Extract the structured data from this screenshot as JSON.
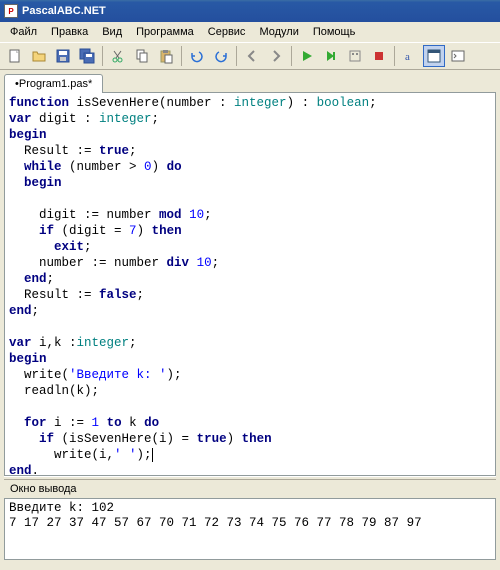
{
  "title": "PascalABC.NET",
  "menu": [
    "Файл",
    "Правка",
    "Вид",
    "Программа",
    "Сервис",
    "Модули",
    "Помощь"
  ],
  "tab": "•Program1.pas*",
  "output_title": "Окно вывода",
  "output_lines": [
    "Введите k: 102",
    "7 17 27 37 47 57 67 70 71 72 73 74 75 76 77 78 79 87 97 "
  ],
  "code": {
    "l1a": "function",
    "l1b": " isSevenHere(number : ",
    "l1c": "integer",
    "l1d": ") : ",
    "l1e": "boolean",
    "l1f": ";",
    "l2a": "var",
    "l2b": " digit : ",
    "l2c": "integer",
    "l2d": ";",
    "l3": "begin",
    "l4a": "  Result := ",
    "l4b": "true",
    "l4c": ";",
    "l5a": "  ",
    "l5b": "while",
    "l5c": " (number > ",
    "l5d": "0",
    "l5e": ") ",
    "l5f": "do",
    "l6": "  begin",
    "l7": "",
    "l8a": "    digit := number ",
    "l8b": "mod",
    "l8c": " ",
    "l8d": "10",
    "l8e": ";",
    "l9a": "    ",
    "l9b": "if",
    "l9c": " (digit = ",
    "l9d": "7",
    "l9e": ") ",
    "l9f": "then",
    "l10a": "      ",
    "l10b": "exit",
    "l10c": ";",
    "l11a": "    number := number ",
    "l11b": "div",
    "l11c": " ",
    "l11d": "10",
    "l11e": ";",
    "l12a": "  ",
    "l12b": "end",
    "l12c": ";",
    "l13a": "  Result := ",
    "l13b": "false",
    "l13c": ";",
    "l14a": "end",
    "l14b": ";",
    "l15": "",
    "l16a": "var",
    "l16b": " i,k :",
    "l16c": "integer",
    "l16d": ";",
    "l17": "begin",
    "l18a": "  write(",
    "l18b": "'Введите k: '",
    "l18c": ");",
    "l19": "  readln(k);",
    "l20": "",
    "l21a": "  ",
    "l21b": "for",
    "l21c": " i := ",
    "l21d": "1",
    "l21e": " ",
    "l21f": "to",
    "l21g": " k ",
    "l21h": "do",
    "l22a": "    ",
    "l22b": "if",
    "l22c": " (isSevenHere(i) = ",
    "l22d": "true",
    "l22e": ") ",
    "l22f": "then",
    "l23a": "      write(i,",
    "l23b": "' '",
    "l23c": ");",
    "l24a": "end",
    "l24b": "."
  }
}
